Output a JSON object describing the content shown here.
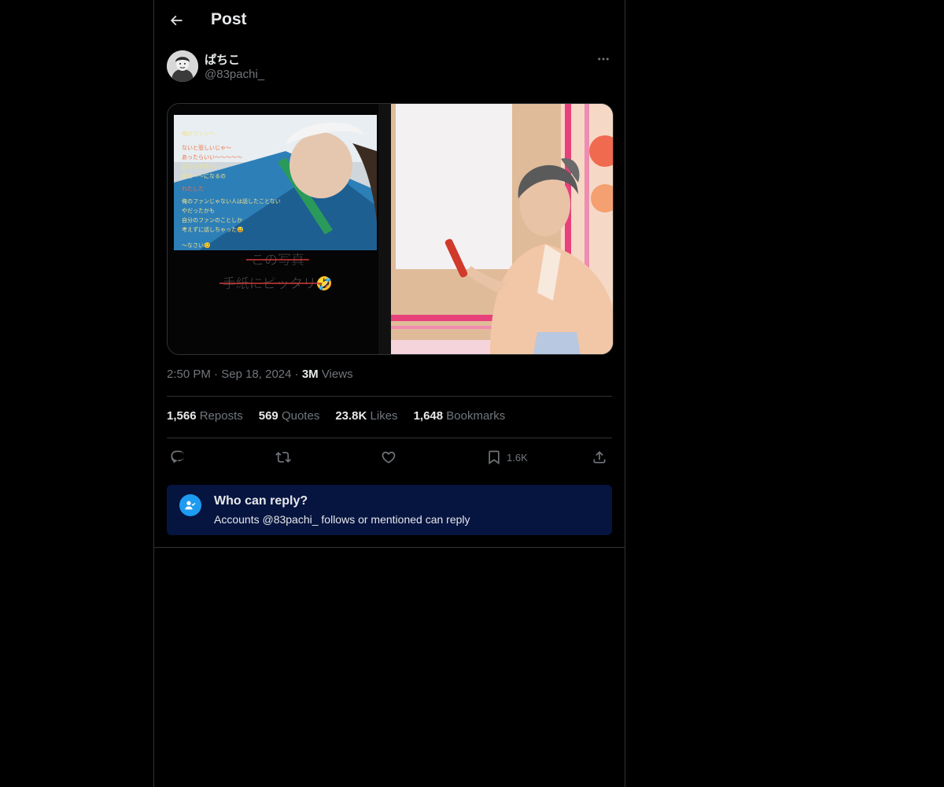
{
  "header": {
    "title": "Post",
    "back_icon": "arrow-left-icon"
  },
  "author": {
    "display_name": "ぱちこ",
    "handle": "@83pachi_",
    "avatar_icon": "avatar-photo",
    "more_icon": "more-dots-icon"
  },
  "media": {
    "left_panel": {
      "lines": [
        "俺のファンへ",
        "ないと悲しいじゃ～",
        "あったらいい～～～～～",
        "変わらず何～～",
        "幸せ～～になるの",
        "わたした",
        "俺のファンじゃない人は話したことない",
        "やだったかも",
        "自分のファンのことしか",
        "考えずに話しちゃった😅",
        "～なさい😊"
      ],
      "caption_line1": "この写真",
      "caption_line2": "手紙にピッタリ🤣"
    }
  },
  "meta": {
    "time": "2:50 PM",
    "separator": "·",
    "date": "Sep 18, 2024",
    "views_count": "3M",
    "views_label": "Views"
  },
  "stats": [
    {
      "count": "1,566",
      "label": "Reposts"
    },
    {
      "count": "569",
      "label": "Quotes"
    },
    {
      "count": "23.8K",
      "label": "Likes"
    },
    {
      "count": "1,648",
      "label": "Bookmarks"
    }
  ],
  "actions": {
    "reply_icon": "reply-icon",
    "repost_icon": "repost-icon",
    "like_icon": "heart-icon",
    "bookmark_icon": "bookmark-icon",
    "bookmark_count": "1.6K",
    "share_icon": "share-icon"
  },
  "reply_restriction": {
    "title": "Who can reply?",
    "subtitle": "Accounts @83pachi_ follows or mentioned can reply",
    "icon": "person-check-icon"
  },
  "colors": {
    "background": "#000000",
    "border": "#2f3336",
    "muted_text": "#71767b",
    "primary_text": "#e7e9ea",
    "accent": "#1d9bf0",
    "reply_box_bg": "#061440"
  }
}
